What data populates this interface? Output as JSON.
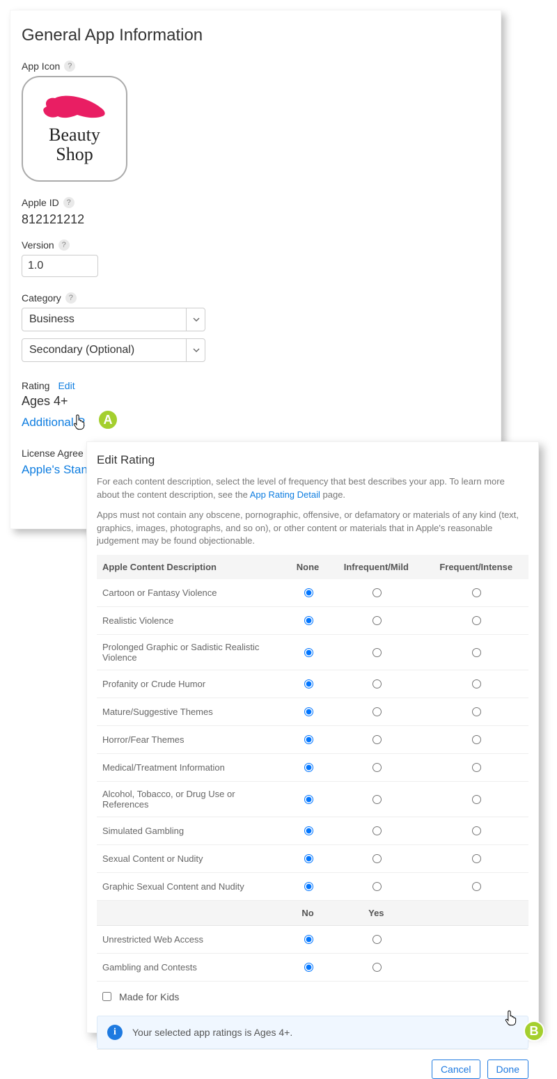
{
  "page": {
    "title": "General App Information",
    "app_icon_label": "App Icon",
    "apple_id_label": "Apple ID",
    "apple_id_value": "812121212",
    "version_label": "Version",
    "version_value": "1.0",
    "category_label": "Category",
    "category_primary": "Business",
    "category_secondary": "Secondary (Optional)",
    "rating_label": "Rating",
    "edit_link": "Edit",
    "rating_value": "Ages 4+",
    "additional_prefix": "Additional R",
    "license_label_partial": "License Agree",
    "license_link_partial": "Apple's Stan",
    "icon_text1": "Beauty",
    "icon_text2": "Shop"
  },
  "callouts": {
    "a": "A",
    "b": "B"
  },
  "modal": {
    "title": "Edit Rating",
    "desc1a": "For each content description, select the level of frequency that best describes your app. To learn more about the content description, see the ",
    "desc1_link": "App Rating Detail",
    "desc1b": " page.",
    "desc2": "Apps must not contain any obscene, pornographic, offensive, or defamatory or materials of any kind (text, graphics, images, photographs, and so on), or other content or materials that in Apple's reasonable judgement may be found objectionable.",
    "head_desc": "Apple Content Description",
    "head_none": "None",
    "head_mild": "Infrequent/Mild",
    "head_freq": "Frequent/Intense",
    "head_no": "No",
    "head_yes": "Yes",
    "rows3": [
      "Cartoon or Fantasy Violence",
      "Realistic Violence",
      "Prolonged Graphic or Sadistic Realistic Violence",
      "Profanity or Crude Humor",
      "Mature/Suggestive Themes",
      "Horror/Fear Themes",
      "Medical/Treatment Information",
      "Alcohol, Tobacco, or Drug Use or References",
      "Simulated Gambling",
      "Sexual Content or Nudity",
      "Graphic Sexual Content and Nudity"
    ],
    "rows2": [
      "Unrestricted Web Access",
      "Gambling and Contests"
    ],
    "made_for_kids": "Made for Kids",
    "info_text": "Your selected app ratings is Ages 4+.",
    "cancel": "Cancel",
    "done": "Done"
  }
}
